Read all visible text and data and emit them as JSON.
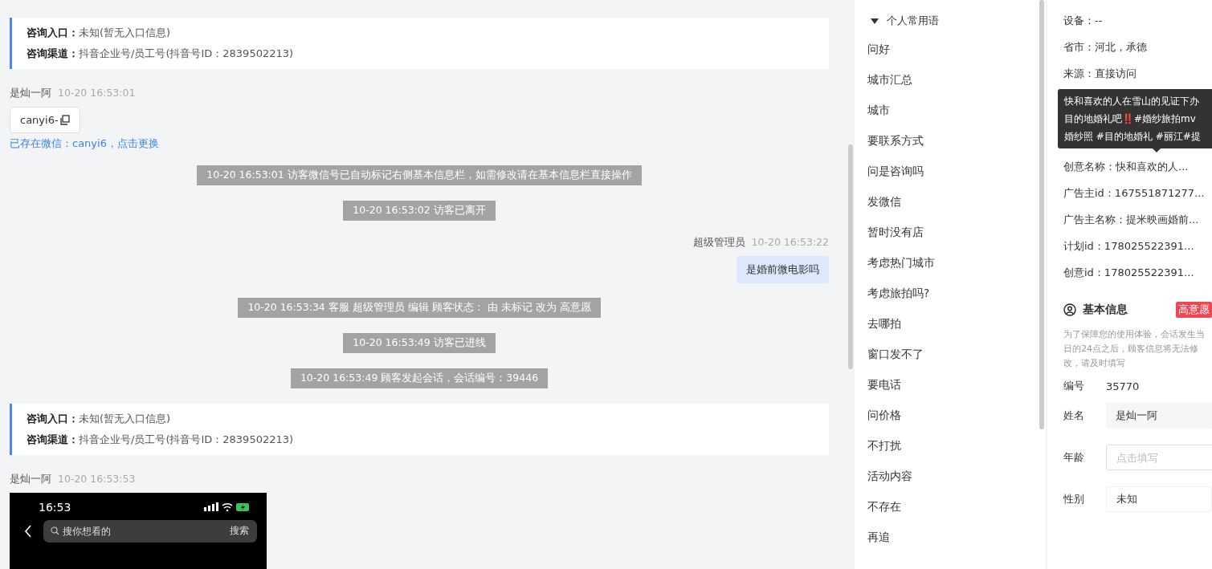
{
  "chat": {
    "messages": [
      {
        "kind": "source",
        "entry_label": "咨询入口：",
        "entry": "未知(暂无入口信息)",
        "channel_label": "咨询渠道：",
        "channel": "抖音企业号/员工号(抖音号ID：2839502213)"
      },
      {
        "kind": "visitor",
        "name": "是灿一阿",
        "time": "10-20 16:53:01",
        "text": "canyi6-",
        "note": "已存在微信：canyi6，点击更换"
      },
      {
        "kind": "system",
        "text": "10-20 16:53:01 访客微信号已自动标记右侧基本信息栏，如需修改请在基本信息栏直接操作"
      },
      {
        "kind": "system",
        "text": "10-20 16:53:02 访客已离开"
      },
      {
        "kind": "agent",
        "name": "超级管理员",
        "time": "10-20 16:53:22",
        "text": "是婚前微电影吗"
      },
      {
        "kind": "system",
        "text": "10-20 16:53:34 客服 超级管理员 编辑 顾客状态： 由 未标记 改为 高意愿"
      },
      {
        "kind": "system",
        "text": "10-20 16:53:49 访客已进线"
      },
      {
        "kind": "system",
        "text": "10-20 16:53:49 顾客发起会话，会话编号：39446"
      },
      {
        "kind": "source",
        "entry_label": "咨询入口：",
        "entry": "未知(暂无入口信息)",
        "channel_label": "咨询渠道：",
        "channel": "抖音企业号/员工号(抖音号ID：2839502213)"
      },
      {
        "kind": "image",
        "name": "是灿一阿",
        "time": "10-20 16:53:53",
        "screenshot": {
          "clock": "16:53",
          "search_placeholder": "搜你想看的",
          "search_button": "搜索"
        }
      }
    ]
  },
  "phrases": {
    "group": "个人常用语",
    "expanded": true,
    "items": [
      "问好",
      "城市汇总",
      "城市",
      "要联系方式",
      "问是咨询吗",
      "发微信",
      "暂时没有店",
      "考虑热门城市",
      "考虑旅拍吗?",
      "去哪拍",
      "窗口发不了",
      "要电话",
      "问价格",
      "不打扰",
      "活动内容",
      "不存在",
      "再追"
    ]
  },
  "info": {
    "rows": [
      "设备：--",
      "省市：河北，承德",
      "来源：直接访问",
      "创意名称：快和喜欢的人...",
      "广告主id：167551871277...",
      "广告主名称：提米映画婚前...",
      "计划id：178025522391...",
      "创意id：178025522391..."
    ],
    "tooltip": {
      "lines": [
        "快和喜欢的人在雪山的见证下办",
        "目的地婚礼吧‼️#婚纱旅拍mv",
        "婚纱照 #目的地婚礼 #丽江#提"
      ]
    },
    "basic": {
      "title": "基本信息",
      "tag": {
        "label": "高意愿",
        "color": "#f04654"
      },
      "notice": "为了保障您的使用体验，会话发生当日的24点之后，顾客信息将无法修改，请及时填写",
      "fields": [
        {
          "kind": "text",
          "label": "编号",
          "value": "35770"
        },
        {
          "kind": "filled",
          "label": "姓名",
          "value": "是灿一阿"
        },
        {
          "kind": "input",
          "label": "年龄",
          "placeholder": "点击填写"
        },
        {
          "kind": "select",
          "label": "性别",
          "value": "未知"
        }
      ]
    }
  }
}
